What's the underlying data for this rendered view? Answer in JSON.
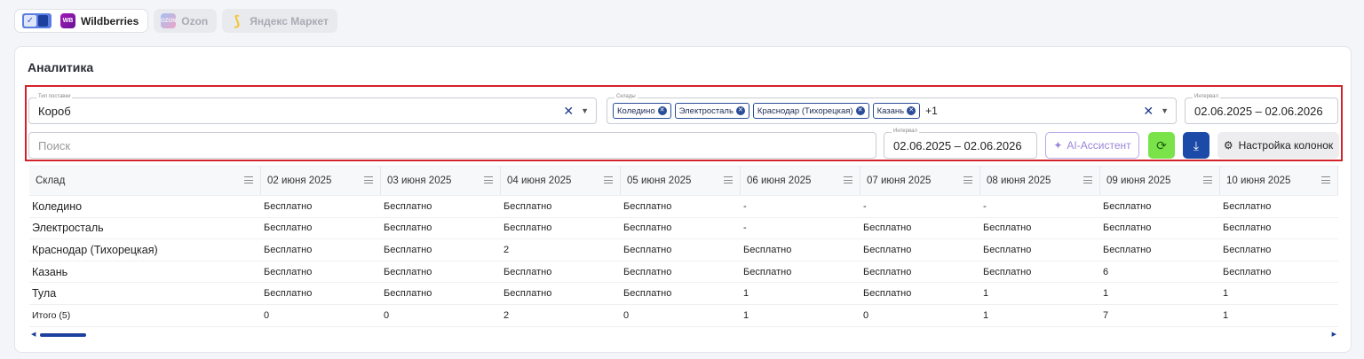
{
  "marketplaces": [
    {
      "logo": "WB",
      "label": "Wildberries",
      "active": true
    },
    {
      "logo": "OZON",
      "label": "Ozon",
      "active": false
    },
    {
      "logo": "⟆",
      "label": "Яндекс Маркет",
      "active": false
    }
  ],
  "card": {
    "title": "Аналитика"
  },
  "filters": {
    "supply_type": {
      "label": "Тип поставки",
      "value": "Короб"
    },
    "warehouses": {
      "label": "Склады",
      "chips": [
        "Коледино",
        "Электросталь",
        "Краснодар (Тихорецкая)",
        "Казань"
      ],
      "more": "+1"
    },
    "interval_top": {
      "label": "Интервал",
      "value": "02.06.2025 – 02.06.2026"
    },
    "search": {
      "placeholder": "Поиск"
    },
    "interval": {
      "label": "Интервал",
      "value": "02.06.2025 – 02.06.2026"
    },
    "ai_button": "AI-Ассистент",
    "columns_button": "Настройка колонок"
  },
  "table": {
    "columns": [
      "Склад",
      "02 июня 2025",
      "03 июня 2025",
      "04 июня 2025",
      "05 июня 2025",
      "06 июня 2025",
      "07 июня 2025",
      "08 июня 2025",
      "09 июня 2025",
      "10 июня 2025"
    ],
    "rows": [
      [
        "Коледино",
        "Бесплатно",
        "Бесплатно",
        "Бесплатно",
        "Бесплатно",
        "-",
        "-",
        "-",
        "Бесплатно",
        "Бесплатно"
      ],
      [
        "Электросталь",
        "Бесплатно",
        "Бесплатно",
        "Бесплатно",
        "Бесплатно",
        "-",
        "Бесплатно",
        "Бесплатно",
        "Бесплатно",
        "Бесплатно"
      ],
      [
        "Краснодар (Тихорецкая)",
        "Бесплатно",
        "Бесплатно",
        "2",
        "Бесплатно",
        "Бесплатно",
        "Бесплатно",
        "Бесплатно",
        "Бесплатно",
        "Бесплатно"
      ],
      [
        "Казань",
        "Бесплатно",
        "Бесплатно",
        "Бесплатно",
        "Бесплатно",
        "Бесплатно",
        "Бесплатно",
        "Бесплатно",
        "6",
        "Бесплатно"
      ],
      [
        "Тула",
        "Бесплатно",
        "Бесплатно",
        "Бесплатно",
        "Бесплатно",
        "1",
        "Бесплатно",
        "1",
        "1",
        "1"
      ]
    ],
    "total": [
      "Итого (5)",
      "0",
      "0",
      "2",
      "0",
      "1",
      "0",
      "1",
      "7",
      "1"
    ]
  },
  "colors": {
    "accent": "#1d3f9e",
    "highlight": "#d2232a",
    "refresh": "#7ae34a"
  }
}
